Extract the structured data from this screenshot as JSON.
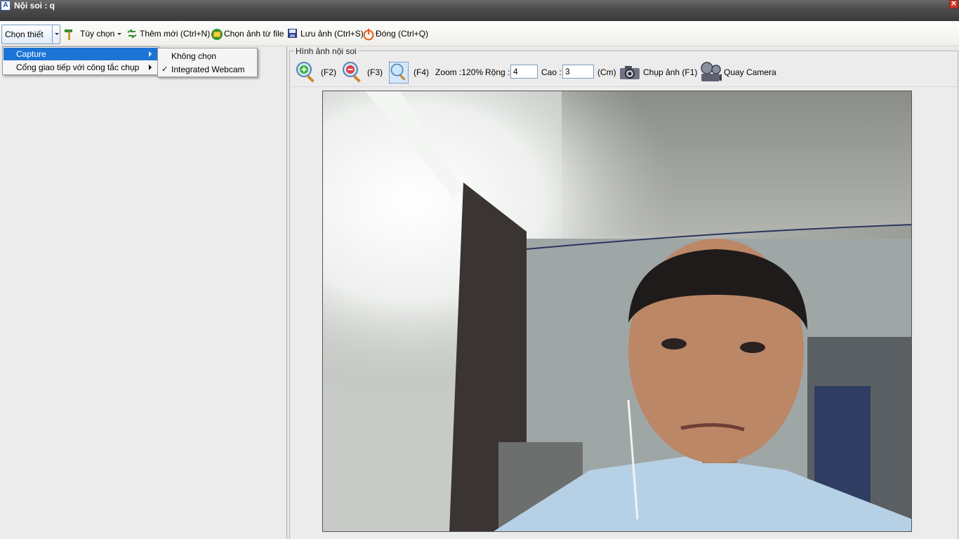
{
  "window": {
    "title": "Nội soi : q",
    "close_glyph": "✕",
    "app_icon_letter": "A"
  },
  "toolbar": {
    "device_select": "Chọn thiết bị",
    "options": "Tùy chọn",
    "add_new": "Thêm mới (Ctrl+N)",
    "choose_from_file": "Chọn ảnh từ file",
    "save_image": "Lưu ảnh (Ctrl+S)",
    "close": "Đóng (Ctrl+Q)"
  },
  "device_menu": {
    "items": [
      {
        "label": "Capture",
        "selected": true
      },
      {
        "label": "Cổng giao tiếp với công tắc chụp",
        "selected": false
      }
    ],
    "submenu": [
      {
        "label": "Không chọn",
        "checked": false
      },
      {
        "label": "Integrated Webcam",
        "checked": true
      }
    ],
    "check_glyph": "✓"
  },
  "image_panel": {
    "group_title": "Hình ảnh nội soi",
    "zoom_in_key": "(F2)",
    "zoom_out_key": "(F3)",
    "zoom_fit_key": "(F4)",
    "zoom_label": "Zoom :120%",
    "width_label": "Rộng :",
    "width_value": "4",
    "height_label": "Cao :",
    "height_value": "3",
    "unit": "(Cm)",
    "capture": "Chụp ảnh (F1)",
    "record": "Quay Camera"
  },
  "colors": {
    "menu_highlight": "#1c74d6",
    "titlebar": "#4b4b4b"
  }
}
